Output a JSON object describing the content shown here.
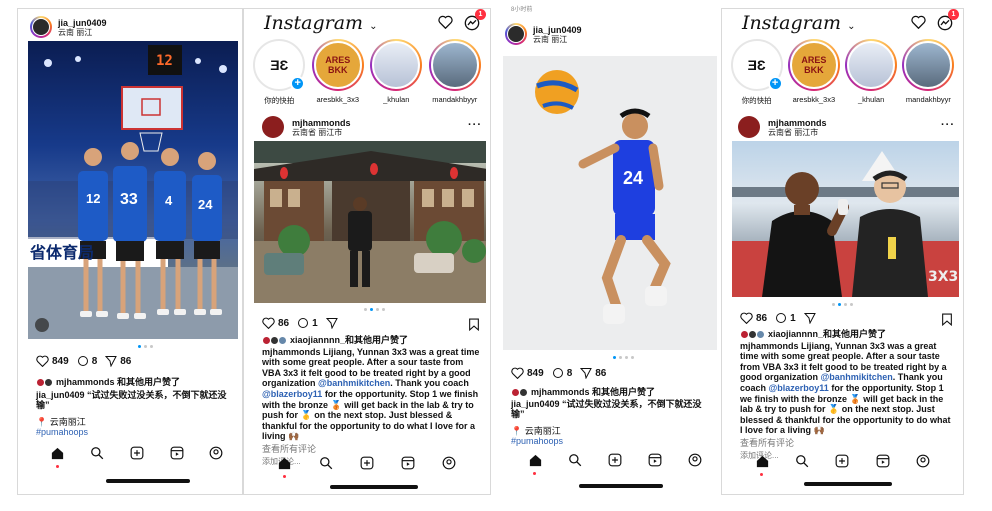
{
  "panel1": {
    "username": "jia_jun0409",
    "location": "云南 丽江",
    "scoreboard": "12",
    "banner_text": "省体育局",
    "jerseys": [
      "12",
      "33",
      "4",
      "24"
    ],
    "likes": "849",
    "comments": "8",
    "shares": "86",
    "liked_by": "mjhammonds 和其他用户赞了",
    "caption_user": "jia_jun0409",
    "caption_text": "“试过失败过没关系，不倒下就还没输”",
    "location_pin": "📍 云南丽江",
    "hashtag": "#pumahoops"
  },
  "panel2": {
    "logo": "Instagram",
    "notif_count": "1",
    "stories": [
      {
        "label": "你的快拍"
      },
      {
        "label": "aresbkk_3x3"
      },
      {
        "label": "_khulan"
      },
      {
        "label": "mandakhbyyr"
      }
    ],
    "username": "mjhammonds",
    "location": "云南省 丽江市",
    "likes": "86",
    "comments": "1",
    "liked_by": "xiaojiannnn_和其他用户赞了",
    "caption_user": "mjhammonds",
    "caption_text": "Lijiang, Yunnan 3x3 was a great time with some great people. After a sour taste from VBA 3x3 it felt good to be treated right by a good organization ",
    "mention1": "@banhmikitchen",
    "caption_mid": ". Thank you coach ",
    "mention2": "@blazerboy11",
    "caption_end": " for the opportunity. Stop 1 we finish with the bronze 🥉 will get back in the lab & try to push for 🥇 on the next stop. Just blessed & thankful for the opportunity to do what I love for a living 🙌🏾",
    "view_comments": "查看所有评论",
    "add_comment": "添加评论..."
  },
  "panel3": {
    "status_time": "8小时前",
    "username": "jia_jun0409",
    "location": "云南 丽江",
    "jersey": "24",
    "likes": "849",
    "comments": "8",
    "shares": "86",
    "liked_by": "mjhammonds 和其他用户赞了",
    "caption_user": "jia_jun0409",
    "caption_text": "“试过失败过没关系，不倒下就还没输”",
    "location_pin": "📍 云南丽江",
    "hashtag": "#pumahoops"
  },
  "panel4": {
    "logo": "Instagram",
    "notif_count": "1",
    "stories": [
      {
        "label": "你的快拍"
      },
      {
        "label": "aresbkk_3x3"
      },
      {
        "label": "_khulan"
      },
      {
        "label": "mandakhbyyr"
      }
    ],
    "username": "mjhammonds",
    "location": "云南省 丽江市",
    "likes": "86",
    "comments": "1",
    "liked_by": "xiaojiannnn_和其他用户赞了",
    "caption_user": "mjhammonds",
    "caption_text": "Lijiang, Yunnan 3x3 was a great time with some great people. After a sour taste from VBA 3x3 it felt good to be treated right by a good organization ",
    "mention1": "@banhmikitchen",
    "caption_mid": ". Thank you coach ",
    "mention2": "@blazerboy11",
    "caption_end": " for the opportunity. Stop 1 we finish with the bronze 🥉 will get back in the lab & try to push for 🥇 on the next stop. Just blessed & thankful for the opportunity to do what I love for a living 🙌🏾",
    "view_comments": "查看所有评论",
    "add_comment": "添加评论..."
  },
  "colors": {
    "accent": "#0095f6",
    "notification": "#ff3040",
    "link": "#2d61b3",
    "court_blue": "#1e5bc6"
  }
}
